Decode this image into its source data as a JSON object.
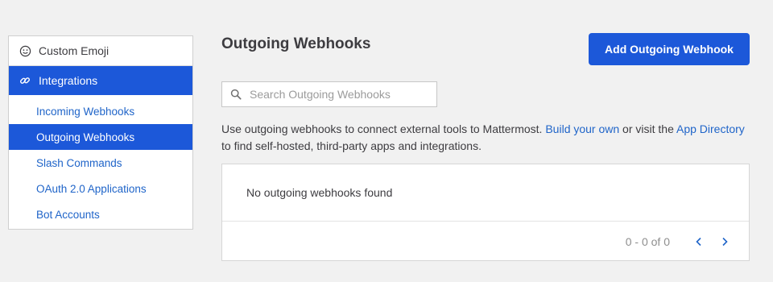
{
  "sidebar": {
    "custom_emoji": {
      "label": "Custom Emoji",
      "icon": "smiley-icon"
    },
    "integrations": {
      "label": "Integrations",
      "icon": "link-icon"
    },
    "items": [
      {
        "label": "Incoming Webhooks",
        "active": false
      },
      {
        "label": "Outgoing Webhooks",
        "active": true
      },
      {
        "label": "Slash Commands",
        "active": false
      },
      {
        "label": "OAuth 2.0 Applications",
        "active": false
      },
      {
        "label": "Bot Accounts",
        "active": false
      }
    ]
  },
  "main": {
    "title": "Outgoing Webhooks",
    "add_button": "Add Outgoing Webhook",
    "search": {
      "placeholder": "Search Outgoing Webhooks",
      "value": ""
    },
    "description": {
      "text1": "Use outgoing webhooks to connect external tools to Mattermost. ",
      "link1": "Build your own",
      "text2": " or visit the ",
      "link2": "App Directory",
      "text3": " to find self-hosted, third-party apps and integrations."
    },
    "empty_message": "No outgoing webhooks found",
    "pagination": {
      "count": "0 - 0 of 0"
    }
  },
  "colors": {
    "accent": "#1c58d9",
    "link": "#2065c9",
    "background": "#f1f1f1"
  }
}
